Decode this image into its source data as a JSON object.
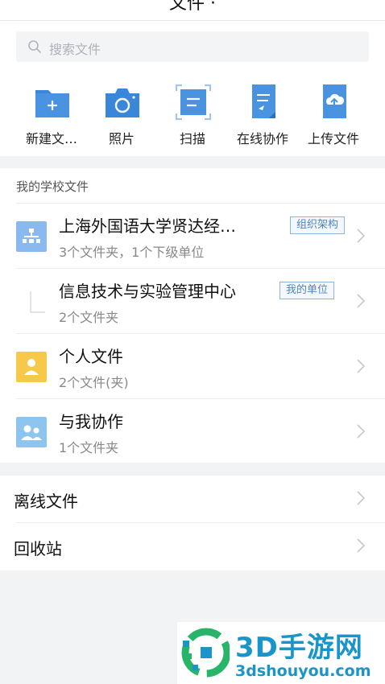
{
  "header": {
    "title": "文件 ·"
  },
  "search": {
    "placeholder": "搜索文件"
  },
  "actions": [
    {
      "label": "新建文…",
      "icon": "new-folder-icon"
    },
    {
      "label": "照片",
      "icon": "camera-icon"
    },
    {
      "label": "扫描",
      "icon": "scan-icon"
    },
    {
      "label": "在线协作",
      "icon": "online-doc-icon"
    },
    {
      "label": "上传文件",
      "icon": "cloud-upload-icon"
    }
  ],
  "school": {
    "heading": "我的学校文件",
    "rows": [
      {
        "title": "上海外国语大学贤达经…",
        "subtitle": "3个文件夹，1个下级单位",
        "tag": "组织架构",
        "icon": "org-structure-icon"
      },
      {
        "title": "信息技术与实验管理中心",
        "subtitle": "2个文件夹",
        "tag": "我的单位",
        "icon": "unit-icon"
      },
      {
        "title": "个人文件",
        "subtitle": "2个文件(夹)",
        "tag": "",
        "icon": "personal-folder-icon"
      },
      {
        "title": "与我协作",
        "subtitle": "1个文件夹",
        "tag": "",
        "icon": "shared-folder-icon"
      }
    ]
  },
  "other": {
    "rows": [
      {
        "label": "离线文件"
      },
      {
        "label": "回收站"
      }
    ]
  },
  "watermark": {
    "big": "3D手游网",
    "small": "3dshouyou.com"
  },
  "colors": {
    "accent": "#3a86d8",
    "tag": "#4a86c5",
    "personal": "#f7c94a",
    "shared": "#8ec5ee",
    "watermark": "#1a95c9"
  }
}
